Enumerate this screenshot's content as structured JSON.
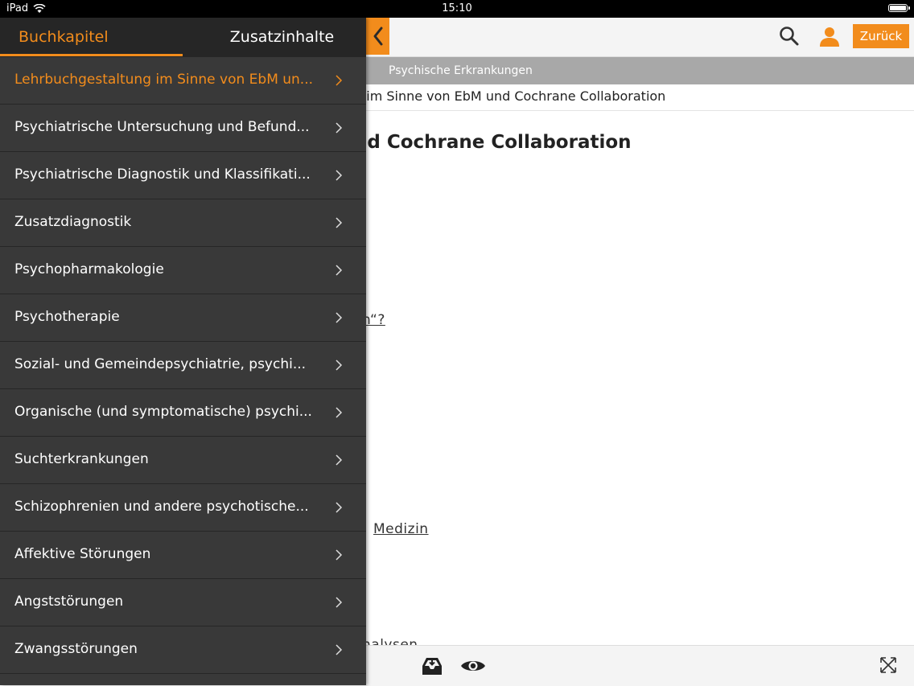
{
  "status_bar": {
    "device": "iPad",
    "time": "15:10",
    "battery_fraction": 1.0
  },
  "header": {
    "back_icon": "chevron-left-icon",
    "search_icon": "search-icon",
    "user_icon": "user-icon",
    "back_label": "Zurück"
  },
  "breadcrumb": "Psychische Erkrankungen",
  "subtitle_visible": "g im Sinne von EbM und Cochrane Collaboration",
  "main": {
    "heading_visible": "nd Cochrane Collaboration",
    "links": [
      {
        "text": "n“?"
      },
      {
        "text": "Medizin"
      },
      {
        "text": "nalysen"
      }
    ]
  },
  "footer": {
    "icons": [
      "inbox-icon",
      "eye-icon",
      "expand-icon"
    ]
  },
  "drawer": {
    "tabs": [
      {
        "label": "Buchkapitel",
        "active": true
      },
      {
        "label": "Zusatzinhalte",
        "active": false
      }
    ],
    "chapters": [
      {
        "label": "Lehrbuchgestaltung im Sinne von EbM un...",
        "active": true
      },
      {
        "label": "Psychiatrische Untersuchung und Befund..."
      },
      {
        "label": "Psychiatrische Diagnostik und Klassifikati..."
      },
      {
        "label": "Zusatzdiagnostik"
      },
      {
        "label": "Psychopharmakologie"
      },
      {
        "label": "Psychotherapie"
      },
      {
        "label": "Sozial- und Gemeindepsychiatrie, psychi..."
      },
      {
        "label": "Organische (und symptomatische) psychi..."
      },
      {
        "label": "Suchterkrankungen"
      },
      {
        "label": "Schizophrenien und andere psychotische..."
      },
      {
        "label": "Affektive Störungen"
      },
      {
        "label": "Angststörungen"
      },
      {
        "label": "Zwangsstörungen"
      }
    ]
  },
  "colors": {
    "accent": "#f28c1c",
    "drawer_bg": "#393939",
    "drawer_tab_bg": "#262626",
    "breadcrumb_bg": "#a8a8a8"
  }
}
